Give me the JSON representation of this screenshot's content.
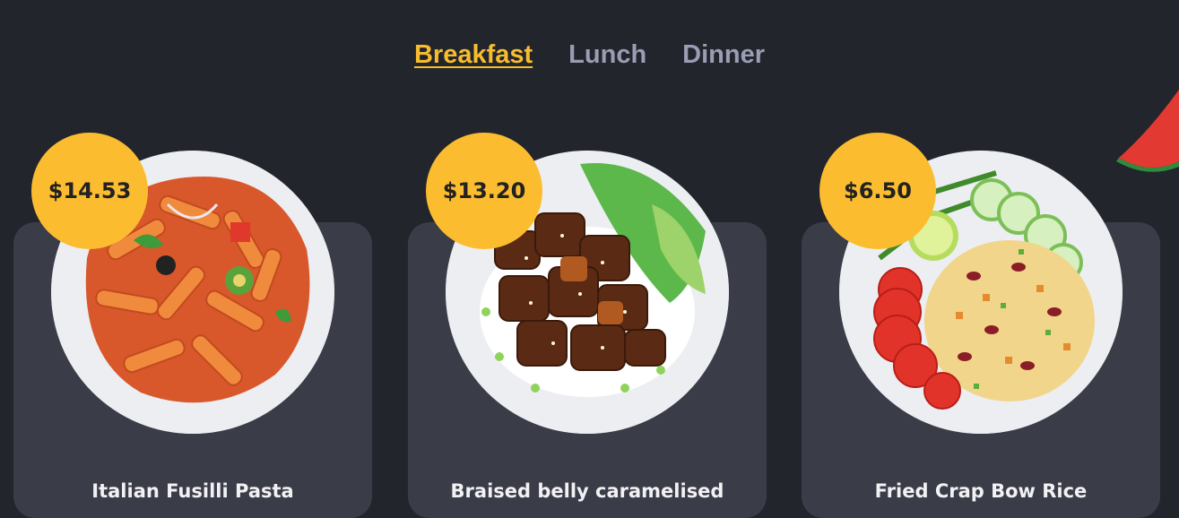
{
  "tabs": [
    {
      "label": "Breakfast",
      "active": true
    },
    {
      "label": "Lunch",
      "active": false
    },
    {
      "label": "Dinner",
      "active": false
    }
  ],
  "dishes": [
    {
      "name": "Italian Fusilli Pasta",
      "price": "$14.53",
      "image": "pasta-plate"
    },
    {
      "name": "Braised belly caramelised",
      "price": "$13.20",
      "image": "braised-pork-plate"
    },
    {
      "name": "Fried Crap Bow Rice",
      "price": "$6.50",
      "image": "fried-rice-plate"
    }
  ],
  "colors": {
    "background": "#23252c",
    "card": "#3a3c48",
    "accent": "#f7bd2f",
    "tab_inactive": "#9a9db3"
  }
}
